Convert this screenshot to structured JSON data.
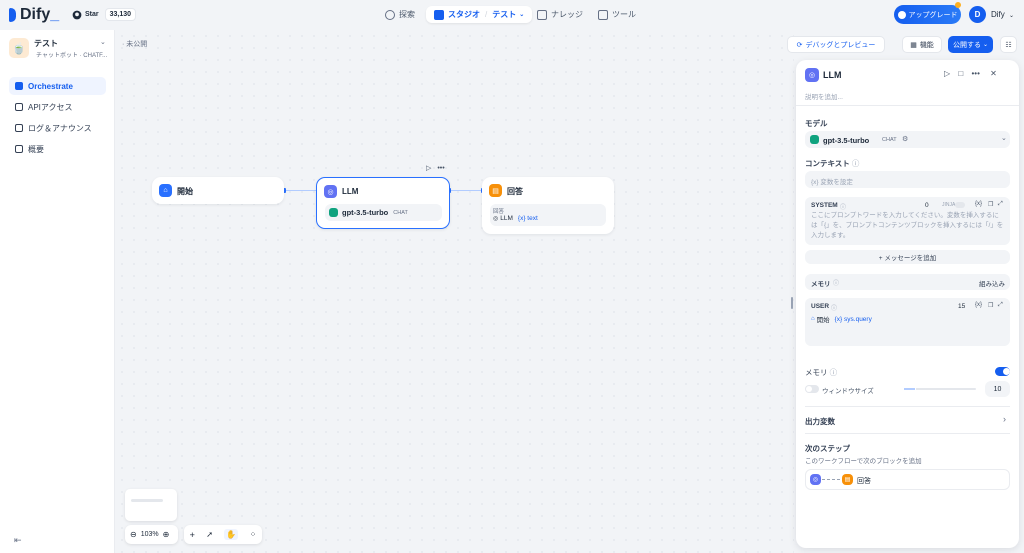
{
  "topbar": {
    "brand": "Dify",
    "github_label": "Star",
    "github_count": "33,130",
    "nav_explore": "探索",
    "nav_studio": "スタジオ",
    "nav_studio_app": "テスト",
    "nav_knowledge": "ナレッジ",
    "nav_tools": "ツール",
    "upgrade": "アップグレード",
    "avatar_initial": "D",
    "username": "Dify"
  },
  "sidebar": {
    "app_name": "テスト",
    "app_type": "チャットボット",
    "app_mode": "CHATF...",
    "items": [
      {
        "label": "Orchestrate"
      },
      {
        "label": "APIアクセス"
      },
      {
        "label": "ログ＆アナウンス"
      },
      {
        "label": "概要"
      }
    ]
  },
  "canvas": {
    "status": "· 未公開",
    "debug_button": "デバッグとプレビュー",
    "features_button": "機能",
    "publish_button": "公開する",
    "zoom": "103%",
    "nodes": {
      "start": {
        "title": "開始"
      },
      "llm": {
        "title": "LLM",
        "model": "gpt-3.5-turbo",
        "mode": "CHAT"
      },
      "answer": {
        "title": "回答",
        "field_label": "回答",
        "ref_node": "LLM",
        "ref_var": "{x} text"
      }
    }
  },
  "panel": {
    "title": "LLM",
    "description_placeholder": "説明を追加...",
    "model_label": "モデル",
    "model_name": "gpt-3.5-turbo",
    "model_mode": "CHAT",
    "context_label": "コンテキスト",
    "context_placeholder": "{x}  変数を設定",
    "system_label": "SYSTEM",
    "system_count": "0",
    "system_jinja": "JINJA",
    "system_placeholder": "ここにプロンプトワードを入力してください。変数を挿入するには「{」を、プロンプトコンテンツブロックを挿入するには「/」を入力します。",
    "add_message": "+ メッセージを追加",
    "memory_label": "メモリ",
    "memory_builtin": "組み込み",
    "user_label": "USER",
    "user_count": "15",
    "user_ref_node": "開始",
    "user_ref_var": "{x} sys.query",
    "memory_toggle_label": "メモリ",
    "memory_toggle_on": true,
    "window_size_label": "ウィンドウサイズ",
    "window_size_value": "10",
    "output_vars": "出力変数",
    "next_step_title": "次のステップ",
    "next_step_desc": "このワークフローで次のブロックを追加",
    "next_step_node": "回答"
  },
  "colors": {
    "accent": "#155eef",
    "start_icon": "#2970ff",
    "llm_icon": "#6172f3",
    "answer_icon": "#f79009",
    "model_icon": "#10a37f"
  }
}
